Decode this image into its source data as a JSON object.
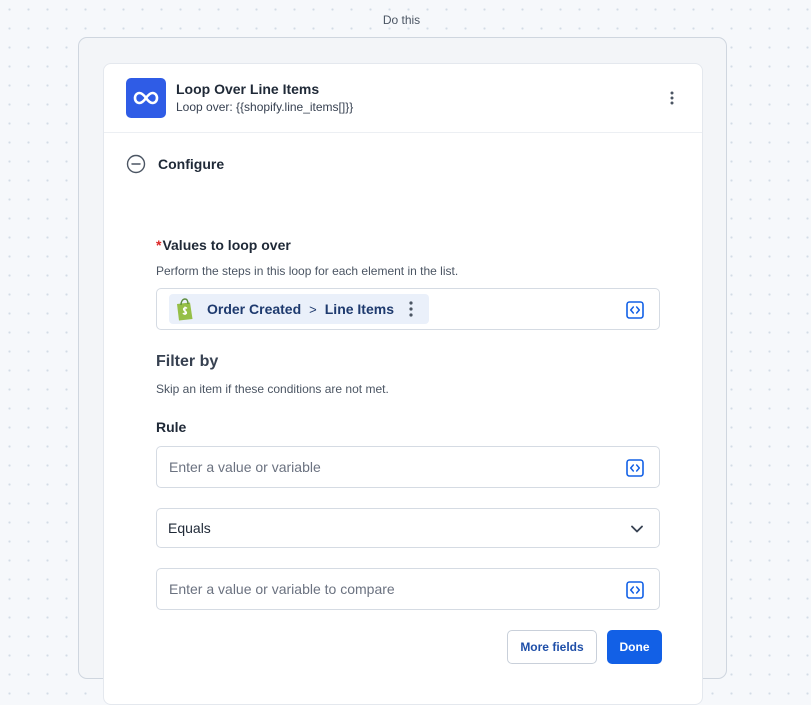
{
  "section": {
    "label": "Do this"
  },
  "step": {
    "icon": "infinity-icon",
    "title": "Loop Over Line Items",
    "subtitle": "Loop over: {{shopify.line_items[]}}"
  },
  "configure": {
    "label": "Configure",
    "icon": "minus-circle-icon"
  },
  "values_field": {
    "required_mark": "*",
    "label": "Values to loop over",
    "help": "Perform the steps in this loop for each element in the list.",
    "pill": {
      "icon": "shopify-bag-icon",
      "source": "Order Created",
      "separator": ">",
      "item": "Line Items"
    }
  },
  "filter": {
    "title": "Filter by",
    "help": "Skip an item if these conditions are not met.",
    "rule_label": "Rule",
    "rule_placeholder": "Enter a value or variable",
    "operator_value": "Equals",
    "compare_placeholder": "Enter a value or variable to compare"
  },
  "actions": {
    "more_fields": "More fields",
    "done": "Done"
  },
  "colors": {
    "accent": "#1260e6",
    "icon_bg": "#2f5ce6",
    "required": "#dc2626",
    "pill_bg": "#eaf0fa"
  }
}
